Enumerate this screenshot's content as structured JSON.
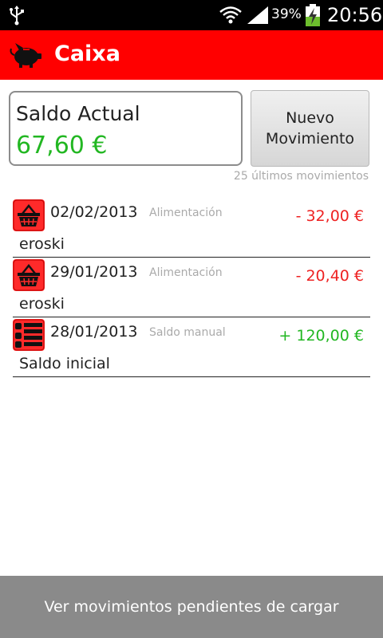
{
  "status_bar": {
    "usb_icon": "usb-icon",
    "wifi_icon": "wifi-icon",
    "signal_icon": "signal-icon",
    "battery_icon": "battery-charging-icon",
    "battery_percent": "39%",
    "time": "20:56"
  },
  "app_bar": {
    "logo_icon": "piggy-bank-icon",
    "title": "Caixa",
    "color": "#ff0000"
  },
  "balance": {
    "label": "Saldo Actual",
    "amount": "67,60 €",
    "amount_color": "#22b722"
  },
  "new_movement_button": {
    "line1": "Nuevo",
    "line2": "Movimiento"
  },
  "last_movements_note": "25 últimos movimientos",
  "movements": [
    {
      "icon": "shopping-basket-icon",
      "date": "02/02/2013",
      "category": "Alimentación",
      "amount": "- 32,00 €",
      "description": "eroski",
      "sign": "negative"
    },
    {
      "icon": "shopping-basket-icon",
      "date": "29/01/2013",
      "category": "Alimentación",
      "amount": "- 20,40 €",
      "description": "eroski",
      "sign": "negative"
    },
    {
      "icon": "list-icon",
      "date": "28/01/2013",
      "category": "Saldo manual",
      "amount": "+ 120,00 €",
      "description": "Saldo inicial",
      "sign": "positive"
    }
  ],
  "pending_button": {
    "label": "Ver movimientos pendientes de cargar"
  },
  "colors": {
    "negative": "#ee2222",
    "positive": "#22b722"
  }
}
